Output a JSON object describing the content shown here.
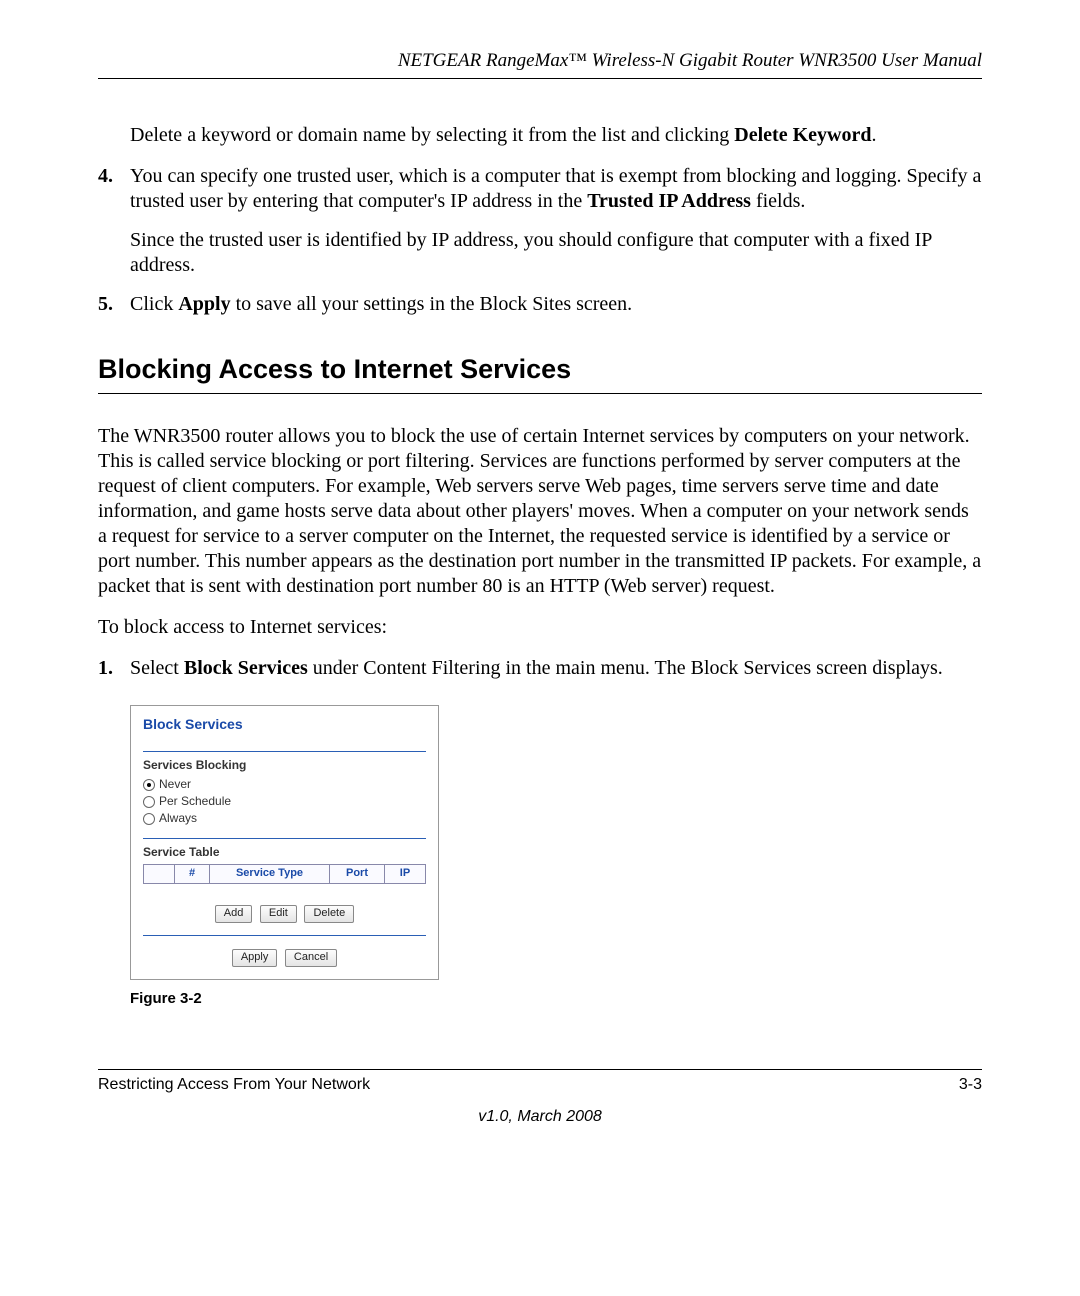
{
  "header": "NETGEAR RangeMax™ Wireless-N Gigabit Router WNR3500 User Manual",
  "intro_para": "Delete a keyword or domain name by selecting it from the list and clicking ",
  "intro_bold": "Delete Keyword",
  "intro_period": ".",
  "list_a": {
    "item4_num": "4.",
    "item4_a": "You can specify one trusted user, which is a computer that is exempt from blocking and logging. Specify a trusted user by entering that computer's IP address in the ",
    "item4_bold": "Trusted IP Address",
    "item4_b": " fields.",
    "item4_sub": "Since the trusted user is identified by IP address, you should configure that computer with a fixed IP address.",
    "item5_num": "5.",
    "item5_a": "Click ",
    "item5_bold": "Apply",
    "item5_b": " to save all your settings in the Block Sites screen."
  },
  "section_title": "Blocking Access to Internet Services",
  "para1": "The WNR3500 router allows you to block the use of certain Internet services by computers on your network. This is called service blocking or port filtering. Services are functions performed by server computers at the request of client computers. For example, Web servers serve Web pages, time servers serve time and date information, and game hosts serve data about other players' moves. When a computer on your network sends a request for service to a server computer on the Internet, the requested service is identified by a service or port number. This number appears as the destination port number in the transmitted IP packets. For example, a packet that is sent with destination port number 80 is an HTTP (Web server) request.",
  "para2": "To block access to Internet services:",
  "list_b": {
    "item1_num": "1.",
    "item1_a": "Select ",
    "item1_bold": "Block Services",
    "item1_b": " under Content Filtering in the main menu. The Block Services screen displays."
  },
  "screenshot": {
    "title": "Block Services",
    "services_blocking": "Services Blocking",
    "opt_never": "Never",
    "opt_per_schedule": "Per Schedule",
    "opt_always": "Always",
    "service_table": "Service Table",
    "col_num": "#",
    "col_service_type": "Service Type",
    "col_port": "Port",
    "col_ip": "IP",
    "btn_add": "Add",
    "btn_edit": "Edit",
    "btn_delete": "Delete",
    "btn_apply": "Apply",
    "btn_cancel": "Cancel"
  },
  "figure_caption": "Figure 3-2",
  "footer_left": "Restricting Access From Your Network",
  "footer_right": "3-3",
  "footer_version": "v1.0, March 2008"
}
